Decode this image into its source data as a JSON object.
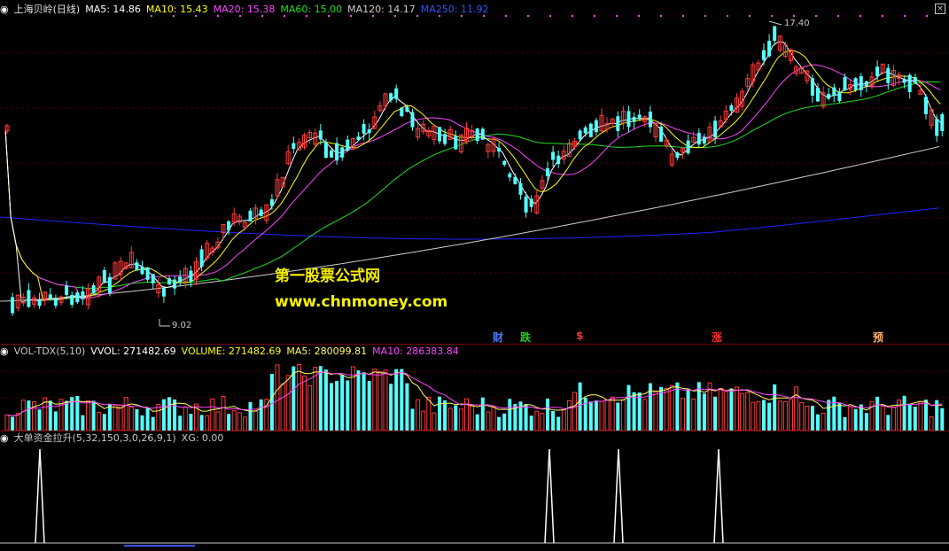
{
  "main_header": {
    "stock_name": "上海贝岭(日线)",
    "ma5": "MA5: 14.86",
    "ma10": "MA10: 15.43",
    "ma20": "MA20: 15.38",
    "ma60": "MA60: 15.00",
    "ma120": "MA120: 14.17",
    "ma250": "MA250: 11.92"
  },
  "price_annotations": {
    "high": "17.40",
    "low": "9.02"
  },
  "watermark": {
    "line1": "第一股票公式网",
    "line2": "www.chnmoney.com"
  },
  "signals": [
    {
      "label": "财",
      "color": "#4a7dff"
    },
    {
      "label": "跌",
      "color": "#22cc22"
    },
    {
      "label": "$",
      "color": "#ff3030"
    },
    {
      "label": "涨",
      "color": "#ff3030"
    },
    {
      "label": "预",
      "color": "#ffb070"
    }
  ],
  "volume_header": {
    "name": "VOL-TDX(5,10)",
    "vvol": "VVOL: 271482.69",
    "volume": "VOLUME: 271482.69",
    "ma5": "MA5: 280099.81",
    "ma10": "MA10: 286383.84"
  },
  "indicator_header": {
    "name": "大单资金拉升(5,32,150,3,0,26,9,1)",
    "xg": "XG: 0.00"
  },
  "colors": {
    "up": "#ff3b3b",
    "down": "#54ffff",
    "ma5": "#ffffff",
    "ma10": "#ffff00",
    "ma20": "#ff44ff",
    "ma60": "#22dd22",
    "ma120": "#cccccc",
    "ma250": "#2222ff"
  },
  "chart_data": {
    "type": "candlestick",
    "title": "上海贝岭(日线)",
    "price_axis": {
      "min": 9.02,
      "max": 17.4
    },
    "moving_averages_last": {
      "MA5": 14.86,
      "MA10": 15.43,
      "MA20": 15.38,
      "MA60": 15.0,
      "MA120": 14.17,
      "MA250": 11.92
    },
    "last_volume": 271482.69,
    "volume_ma": {
      "MA5": 280099.81,
      "MA10": 286383.84
    },
    "indicator_last": {
      "XG": 0.0
    }
  }
}
